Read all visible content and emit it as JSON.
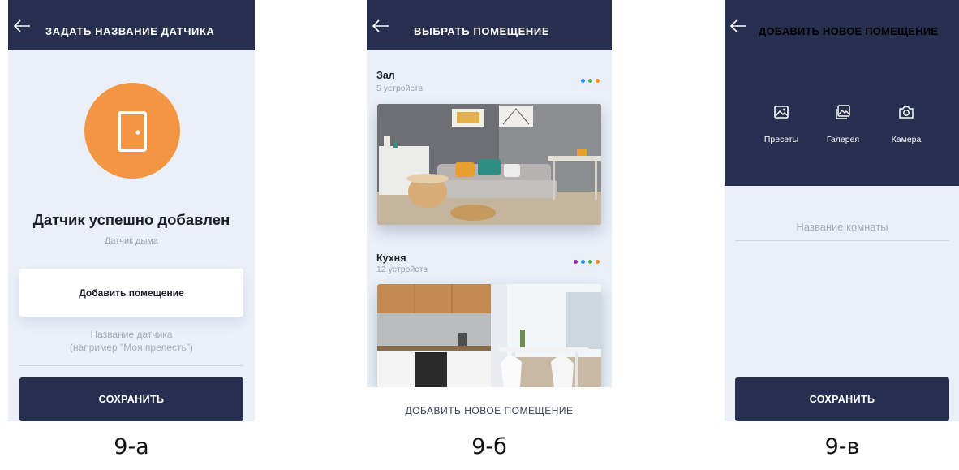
{
  "screen_a": {
    "header_title": "ЗАДАТЬ НАЗВАНИЕ ДАТЧИКА",
    "icon": "door-icon",
    "success_title": "Датчик успешно добавлен",
    "device_type": "Датчик дыма",
    "add_room_label": "Добавить помещение",
    "name_placeholder_line1": "Название датчика",
    "name_placeholder_line2": "(например \"Моя прелесть\")",
    "save_label": "СОХРАНИТЬ",
    "caption": "9-а",
    "colors": {
      "header": "#262f4f",
      "accent": "#f39643",
      "background": "#ebf0f8"
    }
  },
  "screen_b": {
    "header_title": "ВЫБРАТЬ ПОМЕЩЕНИЕ",
    "rooms": [
      {
        "name": "Зал",
        "count": "5 устройств",
        "dot_colors": [
          "#2196f3",
          "#4caf50",
          "#ff8a1e"
        ]
      },
      {
        "name": "Кухня",
        "count": "12 устройств",
        "dot_colors": [
          "#9c27b0",
          "#2196f3",
          "#4caf50",
          "#ff8a1e"
        ]
      }
    ],
    "add_new_label": "ДОБАВИТЬ НОВОЕ ПОМЕЩЕНИЕ",
    "caption": "9-б"
  },
  "screen_c": {
    "header_title": "ДОБАВИТЬ НОВОЕ ПОМЕЩЕНИЕ",
    "sources": [
      {
        "label": "Пресеты",
        "icon": "image-icon"
      },
      {
        "label": "Галерея",
        "icon": "gallery-icon"
      },
      {
        "label": "Камера",
        "icon": "camera-icon"
      }
    ],
    "room_name_placeholder": "Название комнаты",
    "save_label": "СОХРАНИТЬ",
    "caption": "9-в"
  }
}
